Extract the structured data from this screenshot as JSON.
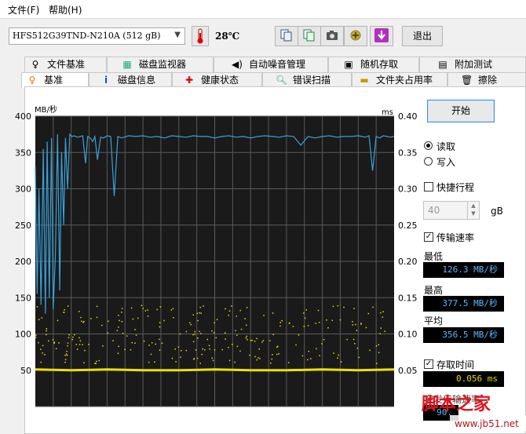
{
  "menu": {
    "file": "文件(F)",
    "help": "帮助(H)"
  },
  "toolbar": {
    "drive": "HFS512G39TND-N210A (512 gB)",
    "temperature": "28℃",
    "exit_label": "退出"
  },
  "tabs_top": [
    "文件基准",
    "磁盘监视器",
    "自动噪音管理",
    "随机存取",
    "附加测试"
  ],
  "tabs_bottom": [
    "基准",
    "磁盘信息",
    "健康状态",
    "错误扫描",
    "文件夹占用率",
    "擦除"
  ],
  "controls": {
    "start_label": "开始",
    "read_label": "读取",
    "write_label": "写入",
    "short_stroke_label": "快捷行程",
    "short_stroke_value": "40",
    "gb_unit": "gB",
    "transfer_rate_label": "传输速率",
    "min_label": "最低",
    "min_value": "126.3 MB/秒",
    "max_label": "最高",
    "max_value": "377.5 MB/秒",
    "avg_label": "平均",
    "avg_value": "356.5 MB/秒",
    "access_time_label": "存取时间",
    "access_time_value": "0.056 ms",
    "burst_rate_partial": "突发传输速率",
    "burst_value_partial": "90."
  },
  "watermark": {
    "text": "脚本之家",
    "url": "www.jb51.net"
  },
  "chart_data": {
    "type": "line",
    "y_left_label": "MB/秒",
    "y_right_label": "ms",
    "y_left_ticks": [
      "400",
      "350",
      "300",
      "250",
      "200",
      "150",
      "100",
      "50"
    ],
    "y_right_ticks": [
      "0.40",
      "0.35",
      "0.30",
      "0.25",
      "0.20",
      "0.15",
      "0.10",
      "0.05"
    ],
    "ylim_left": [
      0,
      400
    ],
    "ylim_right": [
      0,
      0.4
    ],
    "xlim": [
      0,
      100
    ],
    "grid": true,
    "series": [
      {
        "color": "#3aa0d8",
        "x": [
          0,
          0.5,
          1,
          1.6,
          2.2,
          2.8,
          3.3,
          3.9,
          4.5,
          5,
          5.6,
          6.2,
          6.8,
          7.3,
          7.9,
          8.4,
          9,
          9.6,
          10.2,
          10.8,
          11.2,
          11.8,
          12.5,
          13.2,
          14,
          14.6,
          15.3,
          16,
          16.6,
          17.3,
          18.2,
          19,
          20,
          21,
          22,
          23,
          24,
          26,
          28,
          30,
          32,
          34,
          36,
          38,
          40,
          42,
          44,
          46,
          48,
          50,
          52,
          54,
          56,
          58,
          60,
          62,
          64,
          66,
          68,
          70,
          72,
          74,
          76,
          78,
          80,
          82,
          84,
          86,
          88,
          90,
          91,
          92,
          93,
          94,
          95,
          96,
          97,
          98,
          99,
          100
        ],
        "y": [
          330,
          155,
          300,
          140,
          355,
          128,
          365,
          150,
          370,
          134,
          210,
          375,
          160,
          350,
          250,
          370,
          300,
          375,
          372,
          373,
          372,
          371,
          372,
          373,
          335,
          372,
          370,
          365,
          372,
          340,
          371,
          370,
          373,
          372,
          290,
          372,
          370,
          373,
          372,
          373,
          371,
          372,
          370,
          373,
          372,
          371,
          373,
          372,
          372,
          370,
          372,
          373,
          371,
          372,
          370,
          372,
          373,
          372,
          371,
          373,
          372,
          360,
          372,
          370,
          372,
          373,
          371,
          372,
          372,
          373,
          372,
          371,
          373,
          325,
          372,
          370,
          373,
          372,
          371,
          372
        ]
      },
      {
        "color": "#f0e000",
        "x": [
          0,
          10,
          20,
          30,
          40,
          50,
          60,
          70,
          80,
          90,
          100
        ],
        "y": [
          0.051,
          0.05,
          0.051,
          0.05,
          0.05,
          0.051,
          0.05,
          0.05,
          0.051,
          0.05,
          0.051
        ]
      }
    ]
  }
}
